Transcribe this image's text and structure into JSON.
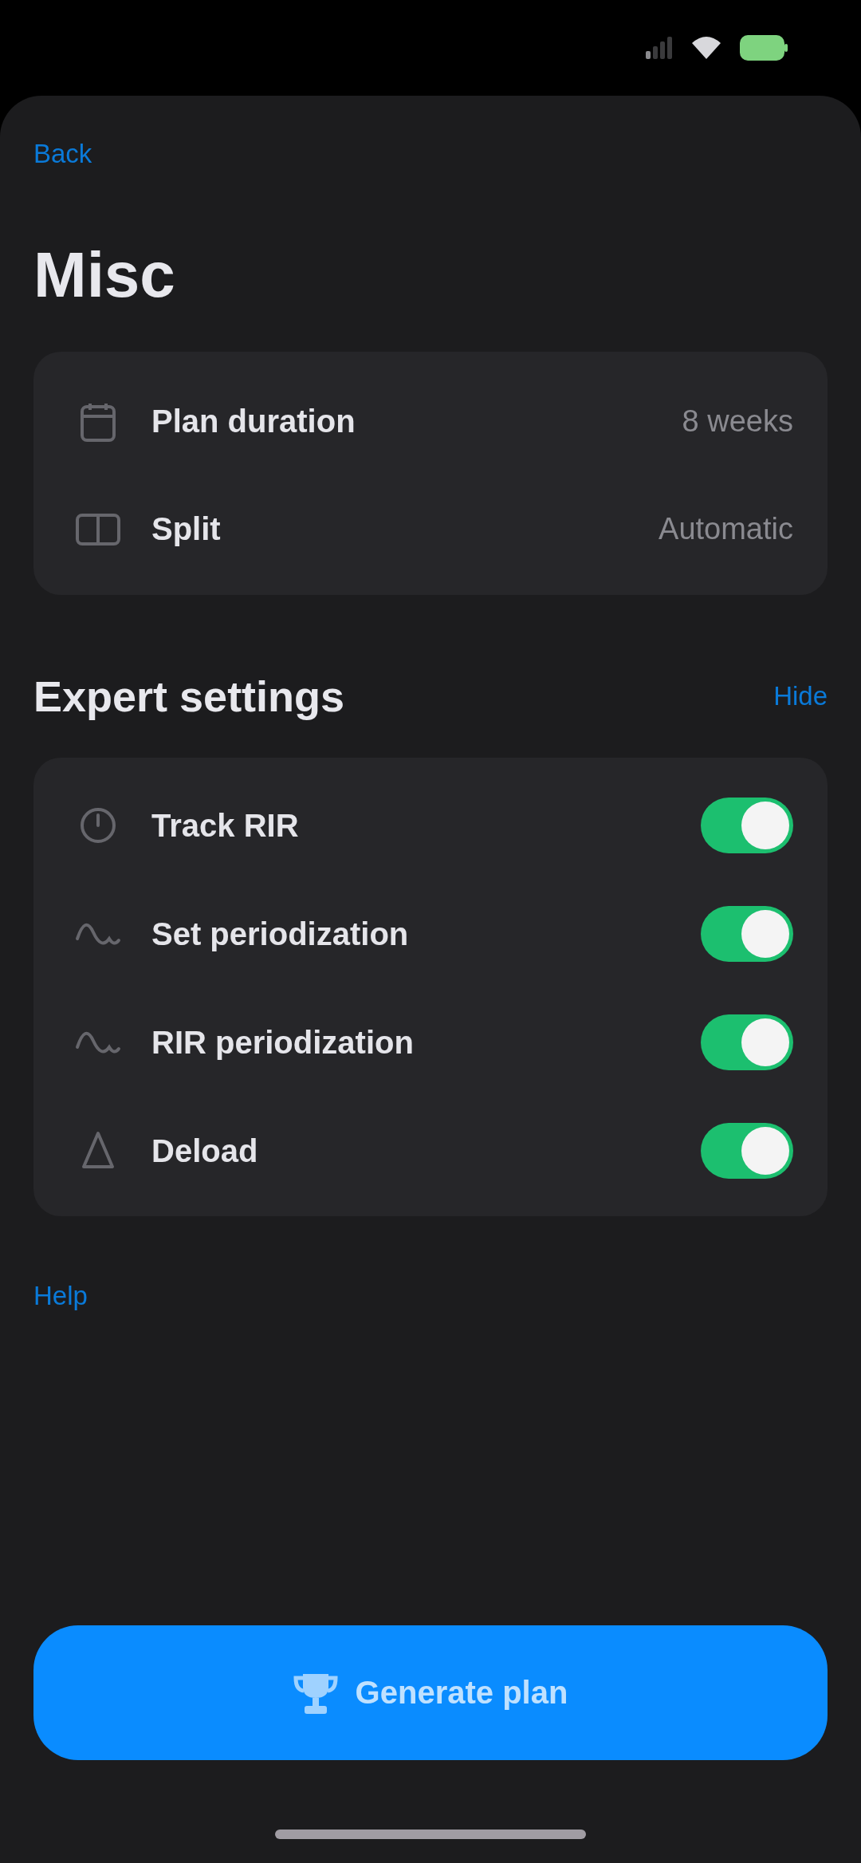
{
  "nav": {
    "back": "Back"
  },
  "title": "Misc",
  "plan_settings": [
    {
      "kind": "calendar",
      "label": "Plan duration",
      "value": "8 weeks"
    },
    {
      "kind": "split",
      "label": "Split",
      "value": "Automatic"
    }
  ],
  "expert": {
    "title": "Expert settings",
    "toggle_link": "Hide",
    "items": [
      {
        "kind": "gauge",
        "label": "Track RIR",
        "on": true
      },
      {
        "kind": "wave",
        "label": "Set periodization",
        "on": true
      },
      {
        "kind": "wave",
        "label": "RIR periodization",
        "on": true
      },
      {
        "kind": "deload",
        "label": "Deload",
        "on": true
      }
    ]
  },
  "help": "Help",
  "primary_button": {
    "label": "Generate plan"
  }
}
